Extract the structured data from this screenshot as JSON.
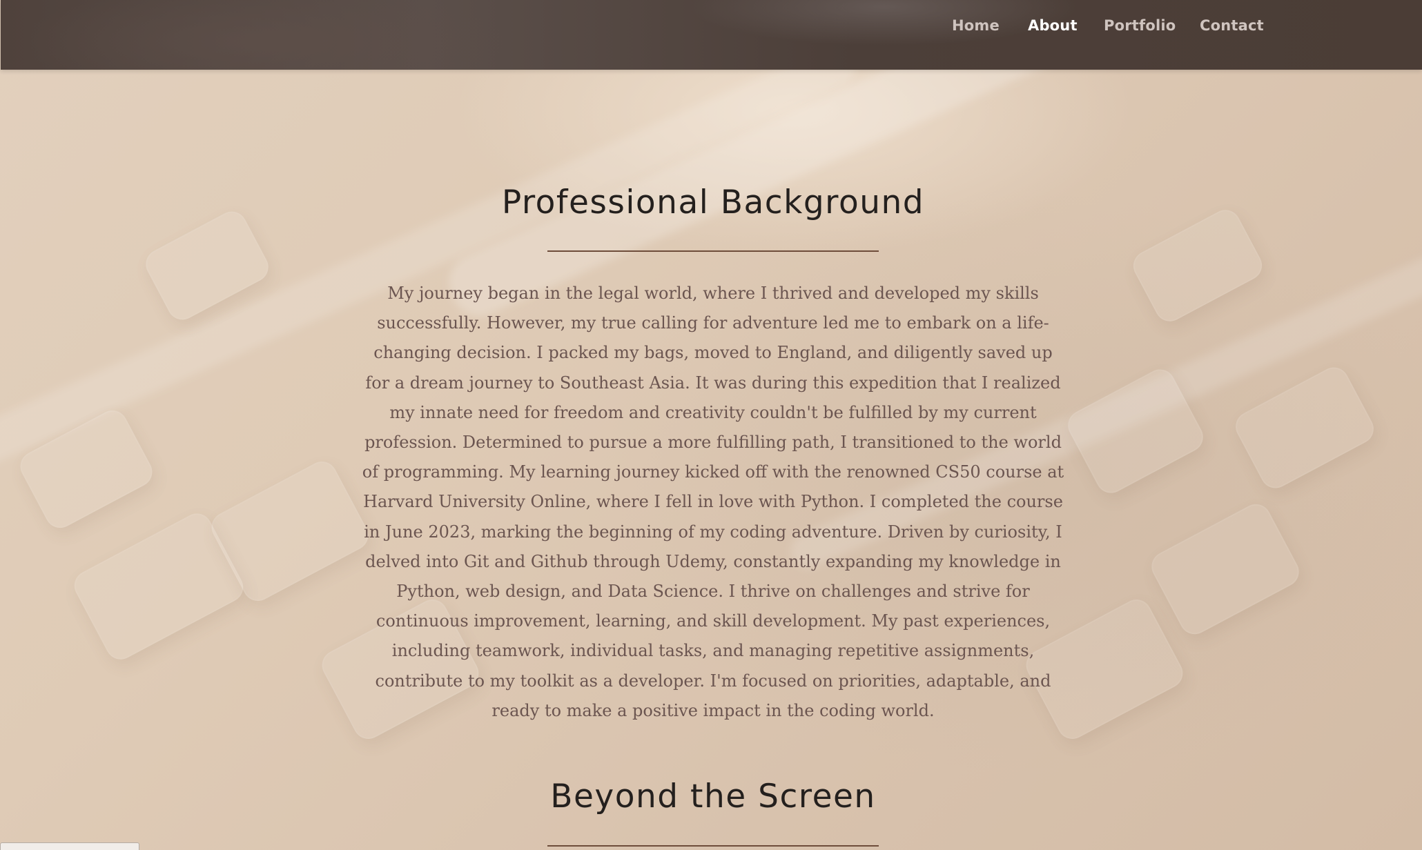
{
  "nav": {
    "items": [
      {
        "label": "Home",
        "active": false
      },
      {
        "label": "About",
        "active": true
      },
      {
        "label": "Portfolio",
        "active": false
      },
      {
        "label": "Contact",
        "active": false
      }
    ]
  },
  "sections": {
    "background": {
      "title": "Professional Background",
      "text": "My journey began in the legal world, where I thrived and developed my skills successfully. However, my true calling for adventure led me to embark on a life-changing decision. I packed my bags, moved to England, and diligently saved up for a dream journey to Southeast Asia. It was during this expedition that I realized my innate need for freedom and creativity couldn't be fulfilled by my current profession. Determined to pursue a more fulfilling path, I transitioned to the world of programming. My learning journey kicked off with the renowned CS50 course at Harvard University Online, where I fell in love with Python. I completed the course in June 2023, marking the beginning of my coding adventure. Driven by curiosity, I delved into Git and Github through Udemy, constantly expanding my knowledge in Python, web design, and Data Science. I thrive on challenges and strive for continuous improvement, learning, and skill development. My past experiences, including teamwork, individual tasks, and managing repetitive assignments, contribute to my toolkit as a developer. I'm focused on priorities, adaptable, and ready to make a positive impact in the coding world."
    },
    "beyond": {
      "title": "Beyond the Screen"
    }
  },
  "colors": {
    "navbar": "#4b3d36",
    "nav_active": "#ffffff",
    "nav_inactive": "#cfc4bf",
    "heading": "#24201e",
    "body_text": "#6b5550",
    "divider": "#6d4c3a",
    "background": "#dcc7b3"
  }
}
